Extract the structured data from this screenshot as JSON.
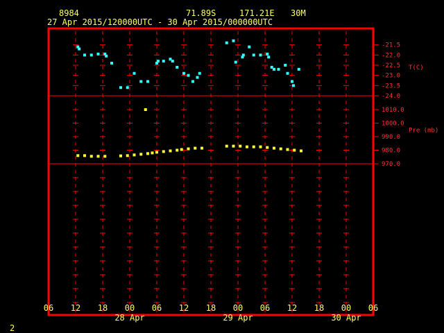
{
  "header": {
    "station_id": "8984",
    "lat": "71.89S",
    "lon": "171.21E",
    "height": "30M",
    "period": "27 Apr 2015/120000UTC - 30 Apr 2015/000000UTC"
  },
  "footer": {
    "page_number": "2"
  },
  "colors": {
    "background": "#000000",
    "frame": "#ff0000",
    "grid": "#ff0000",
    "axis_text": "#ffff66",
    "right_axis_text": "#ff3333",
    "temperature": "#33ffff",
    "pressure": "#ffff33"
  },
  "chart_data": [
    {
      "type": "scatter",
      "name_label": "T(C)",
      "x_unit": "hours since 27 Apr 2015 06 UTC",
      "xlim": [
        0,
        72
      ],
      "ylim": [
        -24.0,
        -21.0
      ],
      "ytick_labels": [
        "-21.5",
        "-22.0",
        "-22.5",
        "-23.0",
        "-23.5",
        "-24.0"
      ],
      "yticks": [
        -21.5,
        -22.0,
        -22.5,
        -23.0,
        -23.5,
        -24.0
      ],
      "points": [
        [
          6.5,
          -21.6
        ],
        [
          6.8,
          -21.7
        ],
        [
          8.0,
          -22.0
        ],
        [
          9.5,
          -22.0
        ],
        [
          11.0,
          -21.95
        ],
        [
          12.5,
          -21.95
        ],
        [
          12.8,
          -22.05
        ],
        [
          14.0,
          -22.4
        ],
        [
          16.0,
          -23.6
        ],
        [
          17.5,
          -23.6
        ],
        [
          19.0,
          -22.9
        ],
        [
          20.5,
          -23.3
        ],
        [
          22.0,
          -23.3
        ],
        [
          24.0,
          -22.4
        ],
        [
          24.3,
          -22.3
        ],
        [
          25.5,
          -22.3
        ],
        [
          27.0,
          -22.2
        ],
        [
          27.5,
          -22.3
        ],
        [
          28.5,
          -22.6
        ],
        [
          30.0,
          -22.9
        ],
        [
          31.0,
          -23.0
        ],
        [
          32.0,
          -23.3
        ],
        [
          33.0,
          -23.1
        ],
        [
          33.5,
          -22.9
        ],
        [
          39.5,
          -21.4
        ],
        [
          41.0,
          -21.3
        ],
        [
          41.5,
          -22.35
        ],
        [
          43.0,
          -22.1
        ],
        [
          43.2,
          -22.0
        ],
        [
          44.5,
          -21.6
        ],
        [
          45.5,
          -22.0
        ],
        [
          47.0,
          -22.0
        ],
        [
          48.5,
          -21.95
        ],
        [
          48.8,
          -22.1
        ],
        [
          49.5,
          -22.6
        ],
        [
          50.0,
          -22.7
        ],
        [
          51.0,
          -22.7
        ],
        [
          52.5,
          -22.5
        ],
        [
          53.0,
          -22.9
        ],
        [
          54.0,
          -23.3
        ],
        [
          54.3,
          -23.5
        ],
        [
          55.5,
          -22.7
        ]
      ]
    },
    {
      "type": "scatter",
      "name_label": "Pre (mb)",
      "x_unit": "hours since 27 Apr 2015 06 UTC",
      "xlim": [
        0,
        72
      ],
      "ylim": [
        970.0,
        1010.0
      ],
      "ytick_labels": [
        "1010.0",
        "1000.0",
        "990.0",
        "980.0",
        "970.0"
      ],
      "yticks": [
        1010,
        1000,
        990,
        980,
        970
      ],
      "points": [
        [
          6.5,
          976.0
        ],
        [
          8.0,
          976.0
        ],
        [
          9.5,
          975.5
        ],
        [
          11.0,
          975.5
        ],
        [
          12.5,
          975.5
        ],
        [
          16.0,
          975.8
        ],
        [
          17.5,
          976.0
        ],
        [
          19.0,
          976.5
        ],
        [
          20.5,
          977.0
        ],
        [
          21.5,
          1010.0
        ],
        [
          22.0,
          977.5
        ],
        [
          23.0,
          978.0
        ],
        [
          24.0,
          978.5
        ],
        [
          25.5,
          979.0
        ],
        [
          27.0,
          979.5
        ],
        [
          28.5,
          980.0
        ],
        [
          29.5,
          980.5
        ],
        [
          31.0,
          981.0
        ],
        [
          32.5,
          981.5
        ],
        [
          34.0,
          981.5
        ],
        [
          39.5,
          983.0
        ],
        [
          41.0,
          983.0
        ],
        [
          42.5,
          983.0
        ],
        [
          44.0,
          982.5
        ],
        [
          45.5,
          982.5
        ],
        [
          47.0,
          982.5
        ],
        [
          48.5,
          982.0
        ],
        [
          50.0,
          981.5
        ],
        [
          51.5,
          981.0
        ],
        [
          53.0,
          980.5
        ],
        [
          54.5,
          980.0
        ],
        [
          56.0,
          979.5
        ]
      ]
    }
  ],
  "x_axis": {
    "hour_ticks": [
      0,
      6,
      12,
      18,
      24,
      30,
      36,
      42,
      48,
      54,
      60,
      66,
      72
    ],
    "hour_labels": [
      "06",
      "12",
      "18",
      "00",
      "06",
      "12",
      "18",
      "00",
      "06",
      "12",
      "18",
      "00",
      "06"
    ],
    "day_labels": [
      {
        "t": 18,
        "text": "28 Apr"
      },
      {
        "t": 42,
        "text": "29 Apr"
      },
      {
        "t": 66,
        "text": "30 Apr"
      }
    ]
  }
}
